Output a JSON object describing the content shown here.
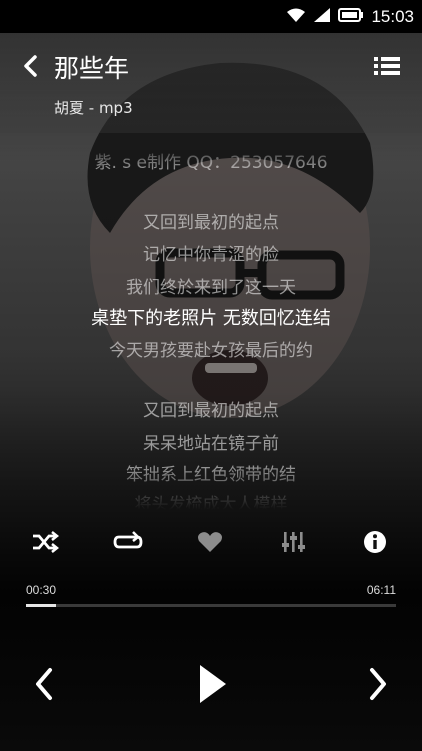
{
  "status": {
    "time": "15:03"
  },
  "header": {
    "title": "那些年",
    "subtitle": "胡夏 - mp3"
  },
  "lyrics": {
    "lines": [
      "紫. s e制作 QQ：253057646",
      "",
      "又回到最初的起点",
      "记忆中你青涩的脸",
      "我们终於来到了这一天",
      "桌垫下的老照片 无数回忆连结",
      "今天男孩要赴女孩最后的约",
      "",
      "又回到最初的起点",
      "呆呆地站在镜子前",
      "笨拙系上红色领带的结",
      "将头发梳成大人模样"
    ],
    "current_index": 5
  },
  "controls": {
    "shuffle": "shuffle-icon",
    "repeat": "repeat-icon",
    "favorite": "heart-icon",
    "equalizer": "equalizer-icon",
    "info": "info-icon"
  },
  "progress": {
    "elapsed": "00:30",
    "total": "06:11",
    "fraction": 0.081
  },
  "colors": {
    "accent": "#ffffff",
    "track": "#3a3a3a"
  }
}
